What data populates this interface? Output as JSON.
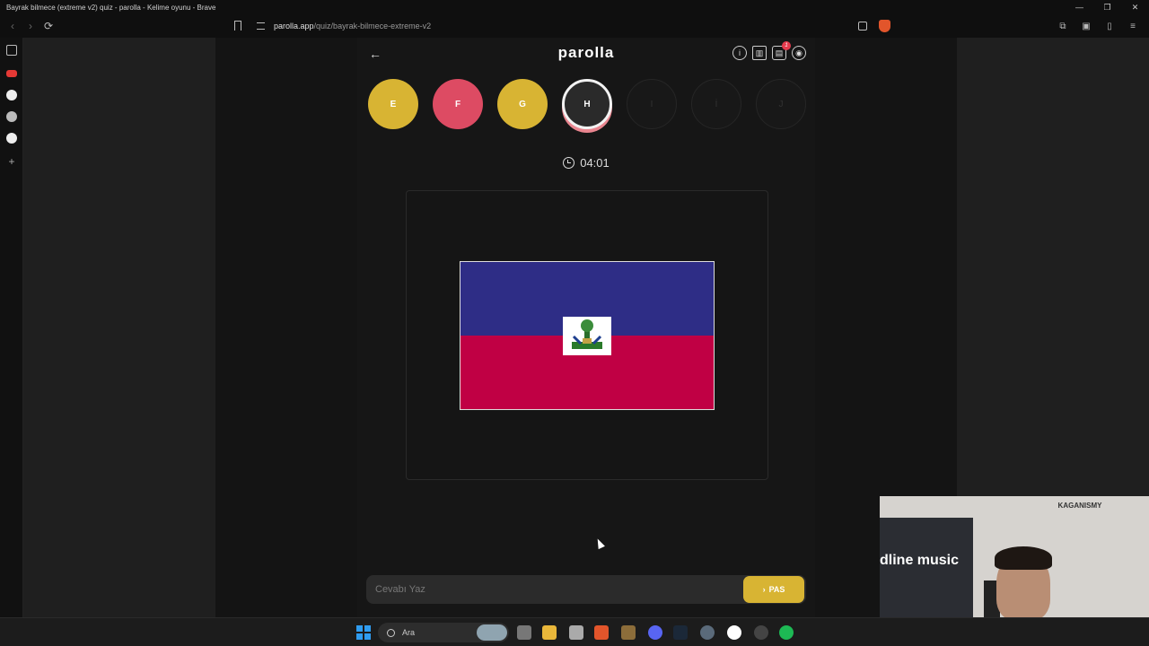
{
  "window": {
    "title": "Bayrak bilmece (extreme v2) quiz - parolla - Kelime oyunu - Brave",
    "controls": [
      "—",
      "❐",
      "✕"
    ]
  },
  "browser": {
    "url_host": "parolla.app",
    "url_path": "/quiz/bayrak-bilmece-extreme-v2",
    "back": "‹",
    "forward": "›",
    "reload": "⟳"
  },
  "app": {
    "logo": "parolla",
    "back_arrow": "←",
    "notification_count": "1",
    "letters": [
      {
        "char": "E",
        "state": "yellow"
      },
      {
        "char": "F",
        "state": "red"
      },
      {
        "char": "G",
        "state": "yellow"
      },
      {
        "char": "H",
        "state": "active"
      },
      {
        "char": "I",
        "state": "empty"
      },
      {
        "char": "İ",
        "state": "empty"
      },
      {
        "char": "J",
        "state": "empty"
      }
    ],
    "timer": "04:01",
    "answer_placeholder": "Cevabı Yaz",
    "pass_label": "PAS",
    "pass_chevron": "›"
  },
  "colors": {
    "accent_yellow": "#d8b433",
    "accent_red": "#dd4b63",
    "flag_blue": "#2e2d86",
    "flag_red": "#c00044"
  },
  "taskbar": {
    "search_label": "Ara"
  },
  "webcam": {
    "sign_text": "dline music",
    "poster_text": "KAGANISMY"
  }
}
